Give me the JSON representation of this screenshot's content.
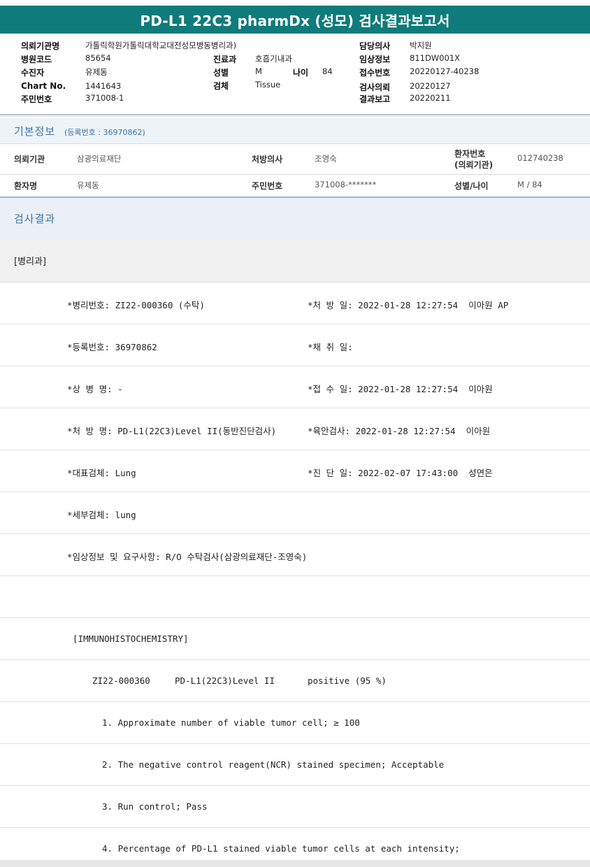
{
  "title": "PD-L1 22C3 pharmDx (성모) 검사결과보고서",
  "header": {
    "institution_label": "의뢰기관명",
    "institution_value": "가톨릭학원가톨릭대학교대전성모병동병리과)",
    "hospital_code_label": "병원코드",
    "hospital_code_value": "85654",
    "dept_label": "진료과",
    "dept_value": "호흡기내과",
    "patient_label": "수진자",
    "patient_value": "유제동",
    "sex_label": "성별",
    "sex_value": "M",
    "age_label": "나이",
    "age_value": "84",
    "chart_label": "Chart No.",
    "chart_value": "1441643",
    "specimen_label": "검체",
    "specimen_value": "Tissue",
    "rrn_label": "주민번호",
    "rrn_value": "371008-1",
    "doctor_label": "담당의사",
    "doctor_value": "박지원",
    "clinical_label": "임상정보",
    "clinical_value": "811DW001X",
    "receipt_label": "접수번호",
    "receipt_value": "20220127-40238",
    "request_label": "검사의뢰",
    "request_value": "20220127",
    "report_label": "결과보고",
    "report_value": "20220211"
  },
  "basic": {
    "title": "기본정보",
    "reg_no": "(등록번호 : 36970862)",
    "row1": {
      "k1": "의뢰기관",
      "v1": "삼광의료재단",
      "k2": "처방의사",
      "v2": "조영숙",
      "k3a": "환자번호",
      "k3b": "(의뢰기관)",
      "v3": "012740238"
    },
    "row2": {
      "k1": "환자명",
      "v1": "유제동",
      "k2": "주민번호",
      "v2": "371008-*******",
      "k3": "성별/나이",
      "v3": "M / 84"
    }
  },
  "results": {
    "title": "검사결과",
    "dept": "[병리과]",
    "lines": [
      {
        "left": "*병리번호: ZI22-000360 (수탁)",
        "right": "*처 방 일: 2022-01-28 12:27:54  이아원 AP"
      },
      {
        "left": "*등록번호: 36970862",
        "right": "*채 취 일:"
      },
      {
        "left": "*상 병 명: -",
        "right": "*접 수 일: 2022-01-28 12:27:54  이아원"
      },
      {
        "left": "*처 방 명: PD-L1(22C3)Level II(동반진단검사)",
        "right": "*육안검사: 2022-01-28 12:27:54  이아원"
      },
      {
        "left": "*대표검체: Lung",
        "right": "*진 단 일: 2022-02-07 17:43:00  성연은"
      },
      {
        "left": "*세부검체: lung",
        "right": ""
      },
      {
        "left": "*임상정보 및 요구사항: R/O 수탁검사(삼광의료재단-조영숙)",
        "right": ""
      }
    ],
    "ihc_header": "[IMMUNOHISTOCHEMISTRY]",
    "ihc_row": {
      "id": "ZI22-000360",
      "test": "PD-L1(22C3)Level II",
      "result": "positive (95 %)"
    },
    "items": [
      "1. Approximate number of viable tumor cell; ≥ 100",
      "2. The negative control reagent(NCR) stained specimen; Acceptable",
      "3. Run control; Pass",
      "4. Percentage of PD-L1 stained viable tumor cells at each intensity;"
    ]
  }
}
